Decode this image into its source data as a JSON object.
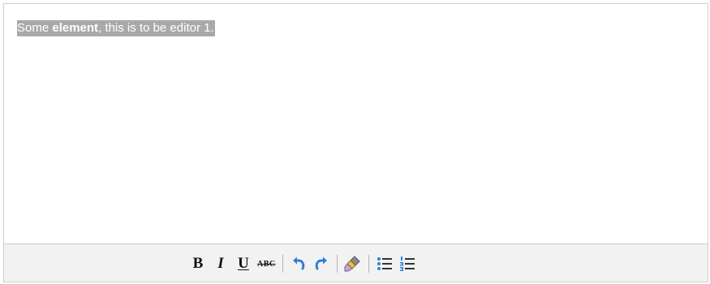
{
  "editor": {
    "content": {
      "text_before": "Some ",
      "text_bold": "element",
      "text_after": ", this is to be editor 1."
    },
    "toolbar": {
      "bold_label": "B",
      "italic_label": "I",
      "underline_label": "U",
      "strikethrough_label": "ABC",
      "icons": [
        "undo-icon",
        "redo-icon",
        "remove-format-icon",
        "bullet-list-icon",
        "numbered-list-icon"
      ]
    },
    "colors": {
      "selection": "#a9a9a9",
      "toolbar_bg": "#f2f2f2",
      "icon_blue": "#2f7fd6",
      "border": "#cfcfcf"
    }
  }
}
